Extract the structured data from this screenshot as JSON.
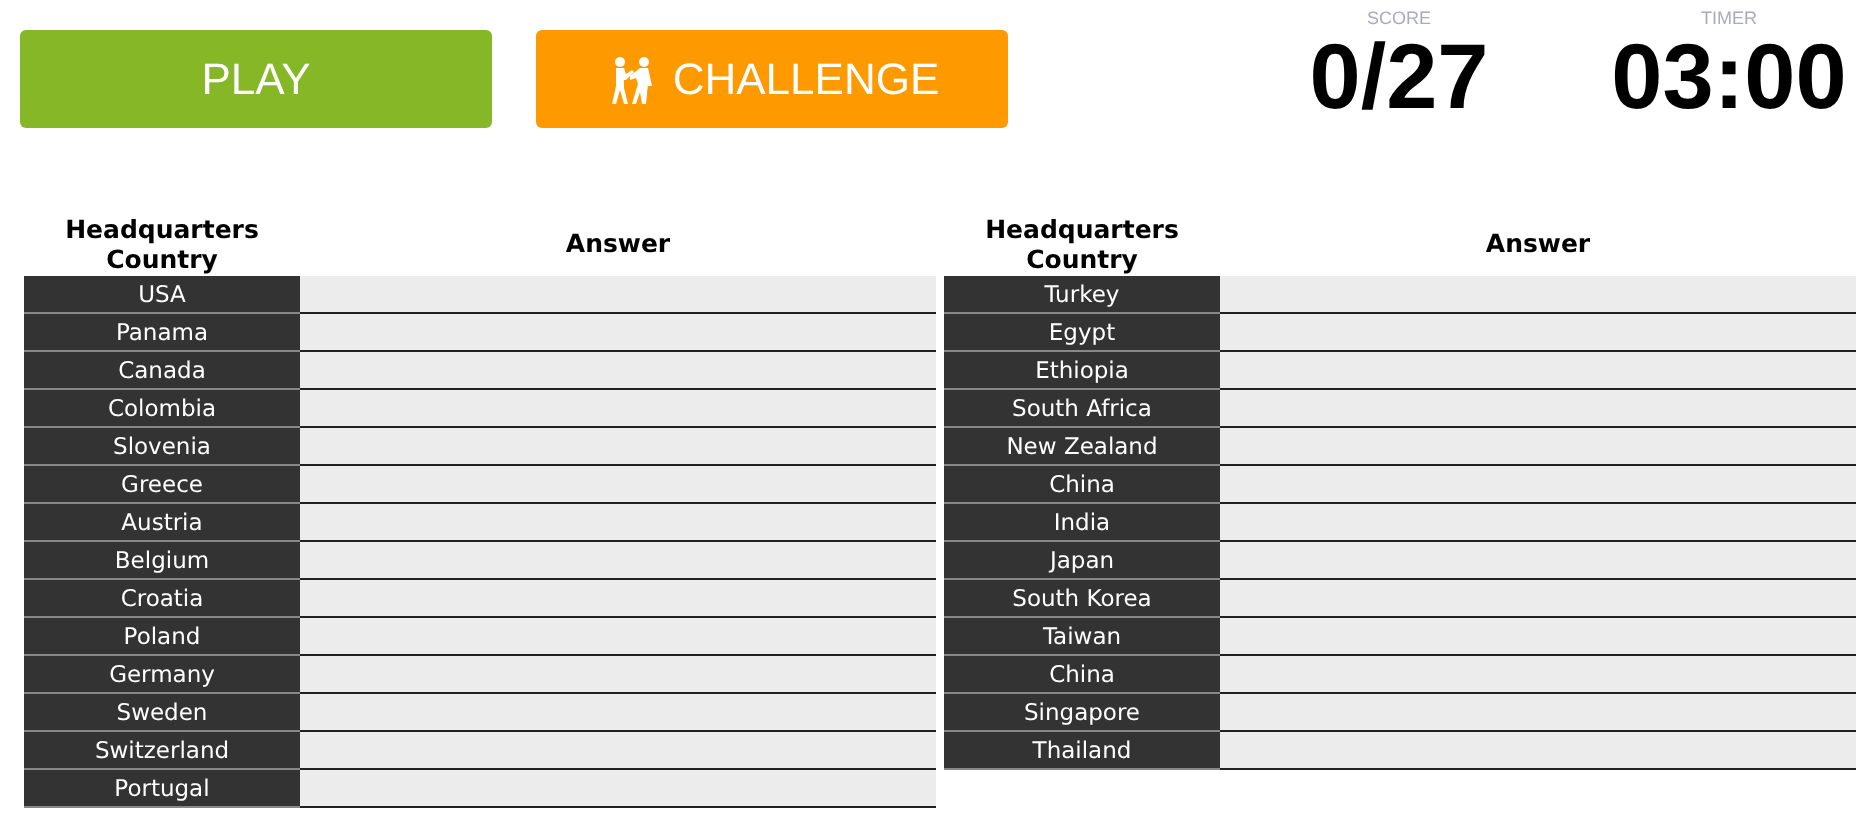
{
  "buttons": [
    {
      "label": "PLAY",
      "kind": "play"
    },
    {
      "label": "CHALLENGE",
      "kind": "challenge"
    }
  ],
  "stats": [
    {
      "label": "SCORE",
      "value": "0/27"
    },
    {
      "label": "TIMER",
      "value": "03:00"
    }
  ],
  "tables": [
    {
      "columns": [
        "Headquarters Country",
        "Answer"
      ],
      "rows": [
        "USA",
        "Panama",
        "Canada",
        "Colombia",
        "Slovenia",
        "Greece",
        "Austria",
        "Belgium",
        "Croatia",
        "Poland",
        "Germany",
        "Sweden",
        "Switzerland",
        "Portugal"
      ]
    },
    {
      "columns": [
        "Headquarters Country",
        "Answer"
      ],
      "rows": [
        "Turkey",
        "Egypt",
        "Ethiopia",
        "South Africa",
        "New Zealand",
        "China",
        "India",
        "Japan",
        "South Korea",
        "Taiwan",
        "China",
        "Singapore",
        "Thailand"
      ]
    }
  ]
}
